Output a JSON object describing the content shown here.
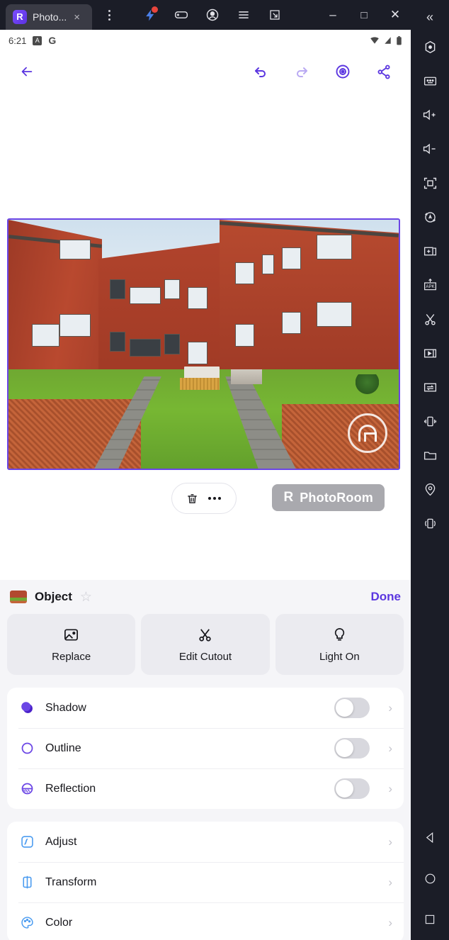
{
  "window": {
    "tab": {
      "title": "Photo...",
      "logo_letter": "R",
      "close_label": "×"
    },
    "menu_kebab": "kebab-menu",
    "toolbar_icons": [
      "boost-icon",
      "gamepad-icon",
      "account-icon",
      "hamburger-menu-icon",
      "popout-icon"
    ],
    "controls": {
      "minimize": "–",
      "maximize": "□",
      "close": "✕",
      "collapse": "«"
    }
  },
  "status_bar": {
    "time": "6:21",
    "badge_letter": "A",
    "google_letter": "G",
    "icons": [
      "wifi-icon",
      "signal-icon",
      "battery-icon"
    ]
  },
  "app_toolbar": {
    "back": "←",
    "undo": "undo-icon",
    "redo": "redo-icon",
    "preview": "eye-icon",
    "share": "share-icon",
    "accent_color": "#5b36e0"
  },
  "canvas": {
    "image_alt": "red brick apartment building with garden paths",
    "selection_color": "#6b46e5",
    "watermark_logo": "house-circle-watermark",
    "object_tools": {
      "delete": "trash-icon",
      "more": "more-dots-icon"
    },
    "branding": {
      "mark": "R",
      "label": "PhotoRoom"
    }
  },
  "panel": {
    "title": "Object",
    "favorite_icon": "☆",
    "done_label": "Done",
    "actions": [
      {
        "icon": "image-icon",
        "label": "Replace"
      },
      {
        "icon": "scissors-icon",
        "label": "Edit Cutout"
      },
      {
        "icon": "bulb-icon",
        "label": "Light On"
      }
    ],
    "toggle_rows": [
      {
        "icon": "shadow-icon",
        "label": "Shadow",
        "enabled": false
      },
      {
        "icon": "outline-icon",
        "label": "Outline",
        "enabled": false
      },
      {
        "icon": "reflection-icon",
        "label": "Reflection",
        "enabled": false
      }
    ],
    "nav_rows": [
      {
        "icon": "adjust-icon",
        "label": "Adjust"
      },
      {
        "icon": "transform-icon",
        "label": "Transform"
      },
      {
        "icon": "color-icon",
        "label": "Color"
      }
    ],
    "chevron": "›"
  },
  "sidebar": {
    "collapse_icon": "«",
    "items": [
      "location-dot-icon",
      "keyboard-icon",
      "volume-up-icon",
      "volume-down-icon",
      "fullscreen-icon",
      "auto-rotate-icon",
      "multi-instance-icon",
      "install-apk-icon",
      "scissors-icon",
      "media-manager-icon",
      "macro-icon",
      "shake-icon",
      "folder-icon",
      "location-pin-icon",
      "tilt-icon"
    ],
    "nav": [
      "back-nav-icon",
      "home-nav-icon",
      "recents-nav-icon"
    ]
  }
}
